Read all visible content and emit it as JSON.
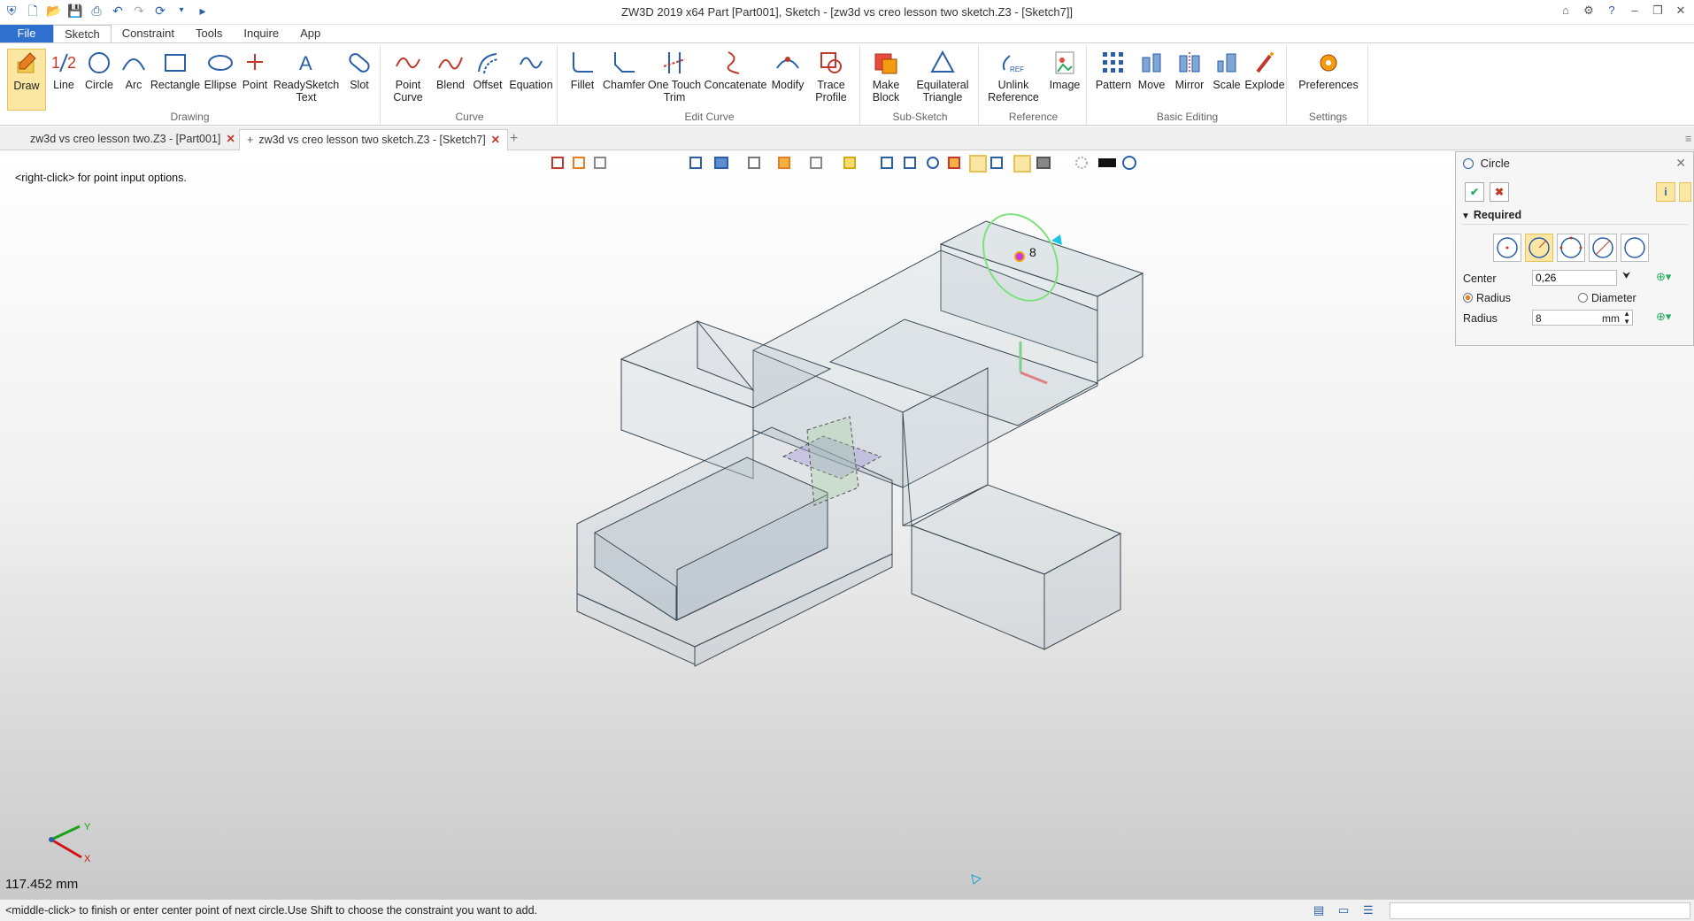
{
  "window": {
    "title": "ZW3D 2019  x64         Part [Part001],  Sketch - [zw3d vs creo lesson two sketch.Z3 - [Sketch7]]"
  },
  "menu": {
    "tabs": [
      {
        "label": "File"
      },
      {
        "label": "Sketch"
      },
      {
        "label": "Constraint"
      },
      {
        "label": "Tools"
      },
      {
        "label": "Inquire"
      },
      {
        "label": "App"
      }
    ]
  },
  "ribbon": {
    "groups": {
      "drawing": "Drawing",
      "curve": "Curve",
      "edit_curve": "Edit Curve",
      "sub_sketch": "Sub-Sketch",
      "reference": "Reference",
      "basic_editing": "Basic Editing",
      "settings": "Settings"
    },
    "buttons": {
      "draw": "Draw",
      "line": "Line",
      "circle": "Circle",
      "arc": "Arc",
      "rectangle": "Rectangle",
      "ellipse": "Ellipse",
      "point": "Point",
      "readysketch_1": "ReadySketch",
      "readysketch_2": "Text",
      "slot": "Slot",
      "point_curve_1": "Point",
      "point_curve_2": "Curve",
      "blend": "Blend",
      "offset": "Offset",
      "equation": "Equation",
      "fillet": "Fillet",
      "chamfer": "Chamfer",
      "one_touch_1": "One Touch",
      "one_touch_2": "Trim",
      "concatenate": "Concatenate",
      "modify": "Modify",
      "trace_1": "Trace",
      "trace_2": "Profile",
      "make_block_1": "Make",
      "make_block_2": "Block",
      "eq_tri_1": "Equilateral",
      "eq_tri_2": "Triangle",
      "unlink_1": "Unlink",
      "unlink_2": "Reference",
      "image": "Image",
      "pattern": "Pattern",
      "move": "Move",
      "mirror": "Mirror",
      "scale": "Scale",
      "explode": "Explode",
      "preferences": "Preferences"
    }
  },
  "doc_tabs": [
    {
      "label": "zw3d vs creo lesson two.Z3 - [Part001]"
    },
    {
      "label": "zw3d vs creo lesson two sketch.Z3 - [Sketch7]"
    }
  ],
  "viewport": {
    "hint": "<right-click> for point input options.",
    "radius_label": "8",
    "measure": "117.452 mm",
    "axis_x": "X",
    "axis_y": "Y"
  },
  "panel": {
    "title": "Circle",
    "section": "Required",
    "center_label": "Center",
    "center_value": "0,26",
    "radius_option": "Radius",
    "diameter_option": "Diameter",
    "radius_label": "Radius",
    "radius_value": "8",
    "unit": "mm"
  },
  "status": {
    "message": "<middle-click> to finish or enter center point of next circle.Use Shift to choose the constraint you want to add."
  },
  "colors": {
    "accent": "#2f6fce",
    "selected": "#fbe7a3",
    "model_edge": "#3b4a55",
    "model_face": "#aebdc6"
  }
}
